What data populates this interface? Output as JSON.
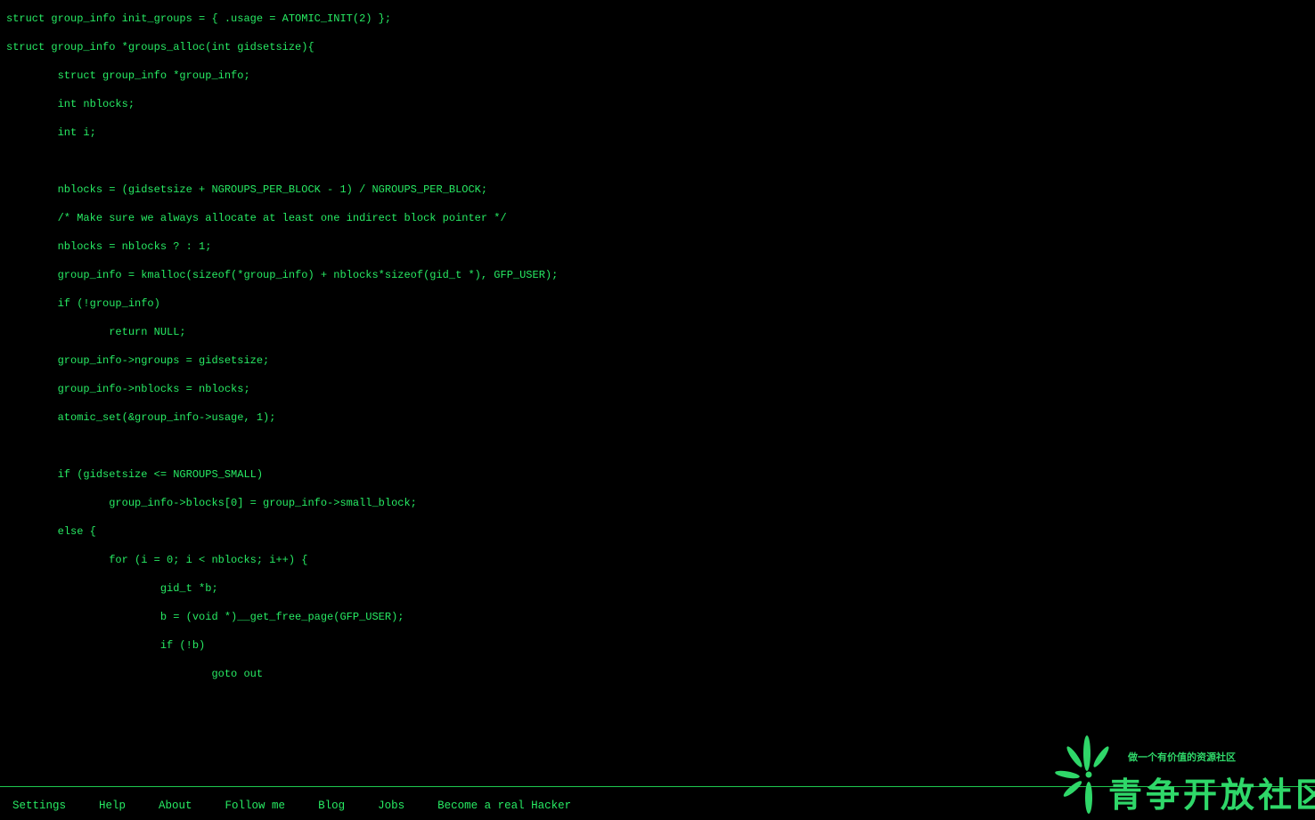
{
  "code": {
    "lines": [
      "struct group_info init_groups = { .usage = ATOMIC_INIT(2) };",
      "struct group_info *groups_alloc(int gidsetsize){",
      "        struct group_info *group_info;",
      "        int nblocks;",
      "        int i;",
      "",
      "        nblocks = (gidsetsize + NGROUPS_PER_BLOCK - 1) / NGROUPS_PER_BLOCK;",
      "        /* Make sure we always allocate at least one indirect block pointer */",
      "        nblocks = nblocks ? : 1;",
      "        group_info = kmalloc(sizeof(*group_info) + nblocks*sizeof(gid_t *), GFP_USER);",
      "        if (!group_info)",
      "                return NULL;",
      "        group_info->ngroups = gidsetsize;",
      "        group_info->nblocks = nblocks;",
      "        atomic_set(&group_info->usage, 1);",
      "",
      "        if (gidsetsize <= NGROUPS_SMALL)",
      "                group_info->blocks[0] = group_info->small_block;",
      "        else {",
      "                for (i = 0; i < nblocks; i++) {",
      "                        gid_t *b;",
      "                        b = (void *)__get_free_page(GFP_USER);",
      "                        if (!b)",
      "                                goto out"
    ]
  },
  "menu": {
    "items": [
      {
        "id": "settings",
        "label": "Settings"
      },
      {
        "id": "help",
        "label": "Help"
      },
      {
        "id": "about",
        "label": "About"
      },
      {
        "id": "follow-me",
        "label": "Follow me"
      },
      {
        "id": "blog",
        "label": "Blog"
      },
      {
        "id": "jobs",
        "label": "Jobs"
      },
      {
        "id": "become-hacker",
        "label": "Become a real Hacker"
      }
    ]
  },
  "watermark": {
    "tagline": "做一个有价值的资源社区",
    "name": "青争开放社区",
    "icon": "green-flower-logo-icon"
  },
  "colors": {
    "background": "#000000",
    "text": "#27ea63",
    "border": "#1ec84e",
    "watermark": "#2fd769"
  }
}
